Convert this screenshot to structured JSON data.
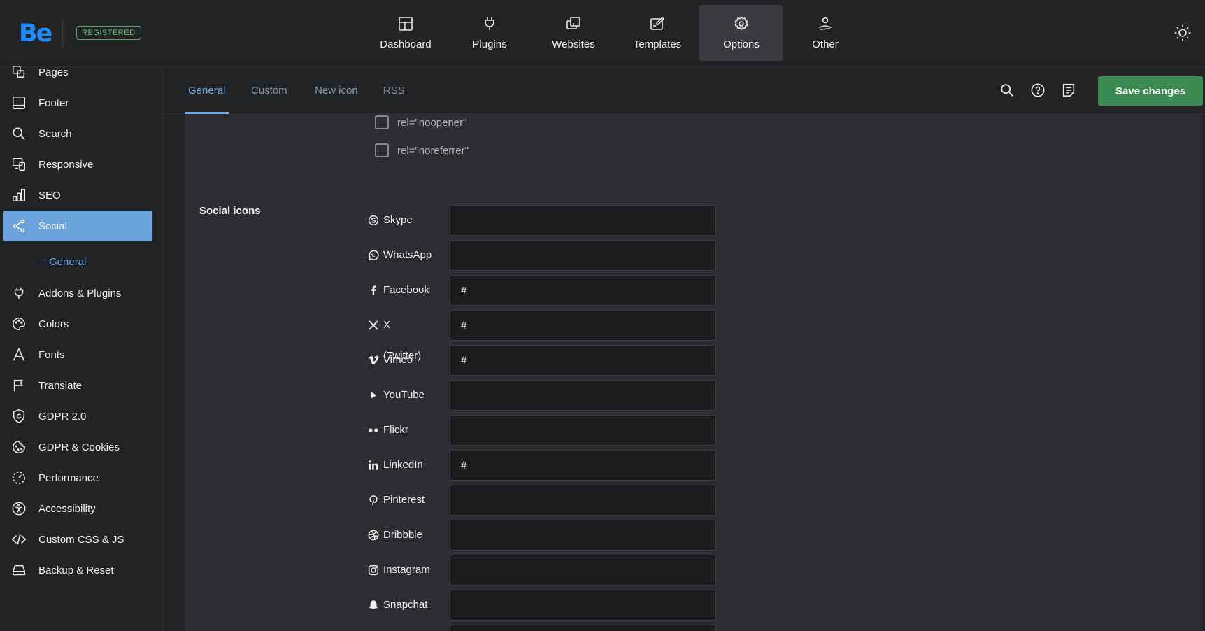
{
  "brand": {
    "logo_text": "Be",
    "badge": "REGISTERED"
  },
  "topnav": [
    {
      "label": "Dashboard",
      "icon": "dashboard-icon"
    },
    {
      "label": "Plugins",
      "icon": "plug-icon"
    },
    {
      "label": "Websites",
      "icon": "websites-icon"
    },
    {
      "label": "Templates",
      "icon": "templates-icon"
    },
    {
      "label": "Options",
      "icon": "gear-icon",
      "active": true
    },
    {
      "label": "Other",
      "icon": "user-hand-icon"
    }
  ],
  "sidebar": {
    "items": [
      {
        "label": "Pages",
        "icon": "pages-icon"
      },
      {
        "label": "Footer",
        "icon": "footer-icon"
      },
      {
        "label": "Search",
        "icon": "search-icon"
      },
      {
        "label": "Responsive",
        "icon": "responsive-icon"
      },
      {
        "label": "SEO",
        "icon": "seo-chart-icon"
      },
      {
        "label": "Social",
        "icon": "share-icon",
        "active": true
      },
      {
        "label": "Addons & Plugins",
        "icon": "plug-icon"
      },
      {
        "label": "Colors",
        "icon": "palette-icon"
      },
      {
        "label": "Fonts",
        "icon": "font-icon"
      },
      {
        "label": "Translate",
        "icon": "flag-icon"
      },
      {
        "label": "GDPR 2.0",
        "icon": "shield-icon"
      },
      {
        "label": "GDPR & Cookies",
        "icon": "cookie-icon"
      },
      {
        "label": "Performance",
        "icon": "performance-icon"
      },
      {
        "label": "Accessibility",
        "icon": "accessibility-icon"
      },
      {
        "label": "Custom CSS & JS",
        "icon": "code-icon"
      },
      {
        "label": "Backup & Reset",
        "icon": "drive-icon"
      }
    ],
    "sub_item": "General"
  },
  "tabs": [
    {
      "label": "General",
      "active": true
    },
    {
      "label": "Custom"
    },
    {
      "label": "New icon"
    },
    {
      "label": "RSS"
    }
  ],
  "toolbar": {
    "save_label": "Save changes"
  },
  "link_options": [
    {
      "label": "rel=\"noopener\"",
      "checked": false
    },
    {
      "label": "rel=\"noreferrer\"",
      "checked": false
    }
  ],
  "social": {
    "section_label": "Social icons",
    "rows": [
      {
        "label": "Skype",
        "value": "",
        "icon": "skype-icon"
      },
      {
        "label": "WhatsApp",
        "value": "",
        "icon": "whatsapp-icon"
      },
      {
        "label": "Facebook",
        "value": "#",
        "icon": "facebook-icon"
      },
      {
        "label": "X (Twitter)",
        "value": "#",
        "icon": "x-twitter-icon"
      },
      {
        "label": "Vimeo",
        "value": "#",
        "icon": "vimeo-icon"
      },
      {
        "label": "YouTube",
        "value": "",
        "icon": "youtube-icon"
      },
      {
        "label": "Flickr",
        "value": "",
        "icon": "flickr-icon"
      },
      {
        "label": "LinkedIn",
        "value": "#",
        "icon": "linkedin-icon"
      },
      {
        "label": "Pinterest",
        "value": "",
        "icon": "pinterest-icon"
      },
      {
        "label": "Dribbble",
        "value": "",
        "icon": "dribbble-icon"
      },
      {
        "label": "Instagram",
        "value": "",
        "icon": "instagram-icon"
      },
      {
        "label": "Snapchat",
        "value": "",
        "icon": "snapchat-icon"
      },
      {
        "label": "",
        "value": "",
        "icon": ""
      }
    ]
  },
  "colors": {
    "accent": "#6aa8e8",
    "active_sidebar": "#6ba3dc",
    "save_button": "#3a8a52",
    "logo": "#1a8cff",
    "registered": "#58c070"
  }
}
